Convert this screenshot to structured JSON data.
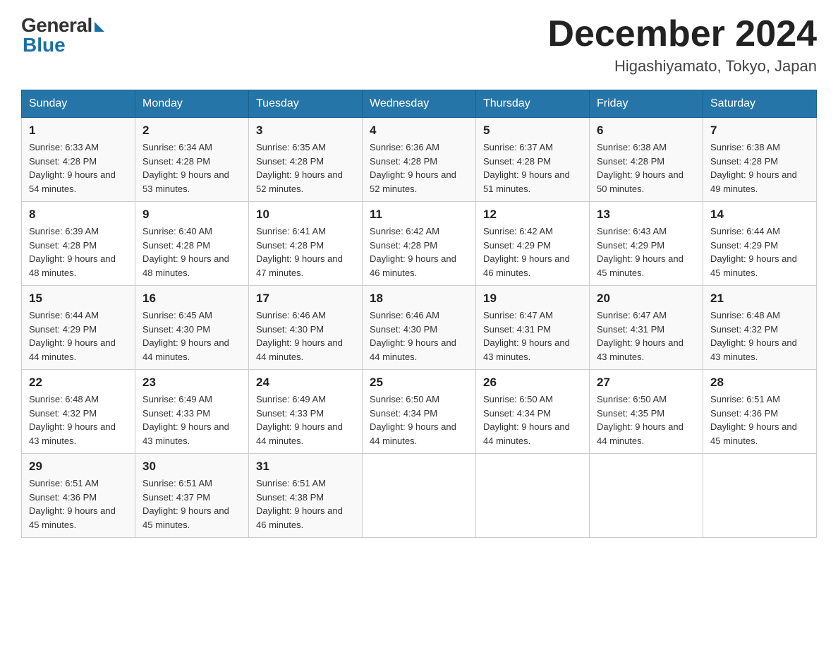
{
  "logo": {
    "general": "General",
    "blue": "Blue"
  },
  "title": "December 2024",
  "location": "Higashiyamato, Tokyo, Japan",
  "days_of_week": [
    "Sunday",
    "Monday",
    "Tuesday",
    "Wednesday",
    "Thursday",
    "Friday",
    "Saturday"
  ],
  "weeks": [
    [
      {
        "day": "1",
        "sunrise": "6:33 AM",
        "sunset": "4:28 PM",
        "daylight": "9 hours and 54 minutes."
      },
      {
        "day": "2",
        "sunrise": "6:34 AM",
        "sunset": "4:28 PM",
        "daylight": "9 hours and 53 minutes."
      },
      {
        "day": "3",
        "sunrise": "6:35 AM",
        "sunset": "4:28 PM",
        "daylight": "9 hours and 52 minutes."
      },
      {
        "day": "4",
        "sunrise": "6:36 AM",
        "sunset": "4:28 PM",
        "daylight": "9 hours and 52 minutes."
      },
      {
        "day": "5",
        "sunrise": "6:37 AM",
        "sunset": "4:28 PM",
        "daylight": "9 hours and 51 minutes."
      },
      {
        "day": "6",
        "sunrise": "6:38 AM",
        "sunset": "4:28 PM",
        "daylight": "9 hours and 50 minutes."
      },
      {
        "day": "7",
        "sunrise": "6:38 AM",
        "sunset": "4:28 PM",
        "daylight": "9 hours and 49 minutes."
      }
    ],
    [
      {
        "day": "8",
        "sunrise": "6:39 AM",
        "sunset": "4:28 PM",
        "daylight": "9 hours and 48 minutes."
      },
      {
        "day": "9",
        "sunrise": "6:40 AM",
        "sunset": "4:28 PM",
        "daylight": "9 hours and 48 minutes."
      },
      {
        "day": "10",
        "sunrise": "6:41 AM",
        "sunset": "4:28 PM",
        "daylight": "9 hours and 47 minutes."
      },
      {
        "day": "11",
        "sunrise": "6:42 AM",
        "sunset": "4:28 PM",
        "daylight": "9 hours and 46 minutes."
      },
      {
        "day": "12",
        "sunrise": "6:42 AM",
        "sunset": "4:29 PM",
        "daylight": "9 hours and 46 minutes."
      },
      {
        "day": "13",
        "sunrise": "6:43 AM",
        "sunset": "4:29 PM",
        "daylight": "9 hours and 45 minutes."
      },
      {
        "day": "14",
        "sunrise": "6:44 AM",
        "sunset": "4:29 PM",
        "daylight": "9 hours and 45 minutes."
      }
    ],
    [
      {
        "day": "15",
        "sunrise": "6:44 AM",
        "sunset": "4:29 PM",
        "daylight": "9 hours and 44 minutes."
      },
      {
        "day": "16",
        "sunrise": "6:45 AM",
        "sunset": "4:30 PM",
        "daylight": "9 hours and 44 minutes."
      },
      {
        "day": "17",
        "sunrise": "6:46 AM",
        "sunset": "4:30 PM",
        "daylight": "9 hours and 44 minutes."
      },
      {
        "day": "18",
        "sunrise": "6:46 AM",
        "sunset": "4:30 PM",
        "daylight": "9 hours and 44 minutes."
      },
      {
        "day": "19",
        "sunrise": "6:47 AM",
        "sunset": "4:31 PM",
        "daylight": "9 hours and 43 minutes."
      },
      {
        "day": "20",
        "sunrise": "6:47 AM",
        "sunset": "4:31 PM",
        "daylight": "9 hours and 43 minutes."
      },
      {
        "day": "21",
        "sunrise": "6:48 AM",
        "sunset": "4:32 PM",
        "daylight": "9 hours and 43 minutes."
      }
    ],
    [
      {
        "day": "22",
        "sunrise": "6:48 AM",
        "sunset": "4:32 PM",
        "daylight": "9 hours and 43 minutes."
      },
      {
        "day": "23",
        "sunrise": "6:49 AM",
        "sunset": "4:33 PM",
        "daylight": "9 hours and 43 minutes."
      },
      {
        "day": "24",
        "sunrise": "6:49 AM",
        "sunset": "4:33 PM",
        "daylight": "9 hours and 44 minutes."
      },
      {
        "day": "25",
        "sunrise": "6:50 AM",
        "sunset": "4:34 PM",
        "daylight": "9 hours and 44 minutes."
      },
      {
        "day": "26",
        "sunrise": "6:50 AM",
        "sunset": "4:34 PM",
        "daylight": "9 hours and 44 minutes."
      },
      {
        "day": "27",
        "sunrise": "6:50 AM",
        "sunset": "4:35 PM",
        "daylight": "9 hours and 44 minutes."
      },
      {
        "day": "28",
        "sunrise": "6:51 AM",
        "sunset": "4:36 PM",
        "daylight": "9 hours and 45 minutes."
      }
    ],
    [
      {
        "day": "29",
        "sunrise": "6:51 AM",
        "sunset": "4:36 PM",
        "daylight": "9 hours and 45 minutes."
      },
      {
        "day": "30",
        "sunrise": "6:51 AM",
        "sunset": "4:37 PM",
        "daylight": "9 hours and 45 minutes."
      },
      {
        "day": "31",
        "sunrise": "6:51 AM",
        "sunset": "4:38 PM",
        "daylight": "9 hours and 46 minutes."
      },
      null,
      null,
      null,
      null
    ]
  ]
}
